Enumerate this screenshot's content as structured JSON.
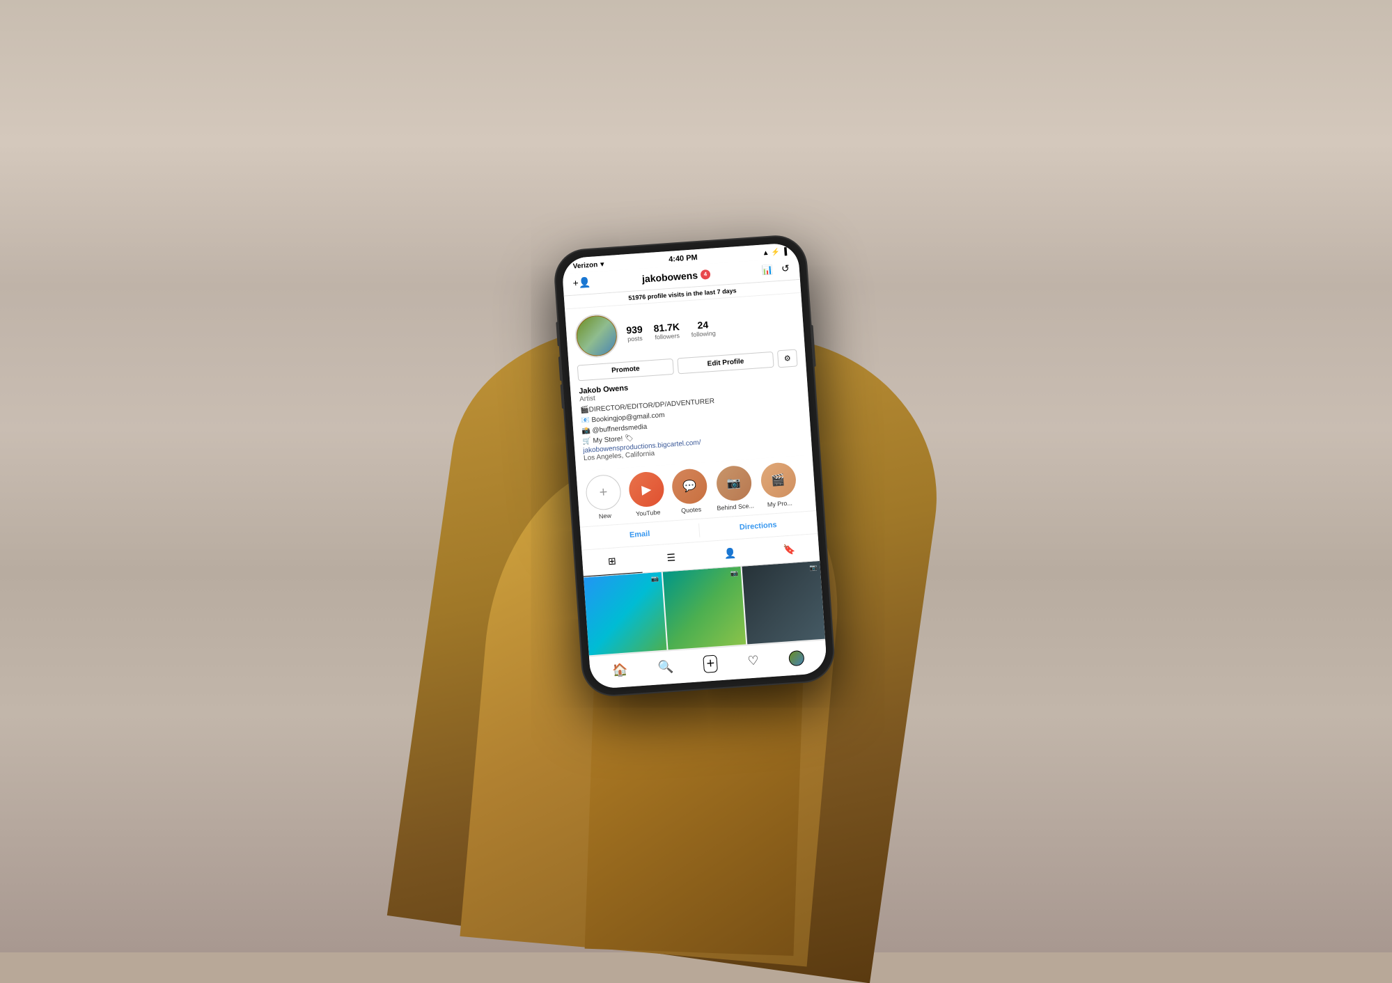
{
  "background": {
    "color": "#b8a898"
  },
  "phone": {
    "status_bar": {
      "carrier": "Verizon",
      "wifi_icon": "wifi",
      "time": "4:40 PM",
      "signal_icon": "signal",
      "bluetooth_icon": "bluetooth",
      "battery_icon": "battery"
    },
    "nav": {
      "add_user_icon": "+👤",
      "username": "jakobowens",
      "badge": "4",
      "chart_icon": "📶",
      "history_icon": "↺"
    },
    "insights": {
      "count": "51976",
      "text": " profile visits in the last 7 days"
    },
    "profile": {
      "stats": [
        {
          "number": "939",
          "label": "posts"
        },
        {
          "number": "81.7K",
          "label": "followers"
        },
        {
          "number": "24",
          "label": "following"
        }
      ],
      "buttons": {
        "promote": "Promote",
        "edit_profile": "Edit Profile",
        "settings": "⚙"
      },
      "bio": {
        "name": "Jakob Owens",
        "category": "Artist",
        "lines": [
          "🎬DIRECTOR/EDITOR/DP/ADVENTURER",
          "📧 Bookingjop@gmail.com",
          "📸 @buffnerdsmedia",
          "🛒 My Store! 🏷",
          "jakobowensproductions.bigcartel.com/",
          "Los Angeles, California"
        ]
      }
    },
    "highlights": [
      {
        "id": "new",
        "label": "New",
        "icon": "+"
      },
      {
        "id": "youtube",
        "label": "YouTube",
        "icon": "▶"
      },
      {
        "id": "quotes",
        "label": "Quotes",
        "icon": "💬"
      },
      {
        "id": "behind",
        "label": "Behind Sce...",
        "icon": "📷"
      },
      {
        "id": "mypro",
        "label": "My Pro...",
        "icon": ""
      }
    ],
    "contact": {
      "email": "Email",
      "directions": "Directions"
    },
    "view_tabs": [
      {
        "id": "grid",
        "icon": "⊞",
        "active": true
      },
      {
        "id": "list",
        "icon": "☰",
        "active": false
      },
      {
        "id": "tag",
        "icon": "👤",
        "active": false
      },
      {
        "id": "bookmark",
        "icon": "🔖",
        "active": false
      }
    ],
    "bottom_nav": [
      {
        "id": "home",
        "icon": "🏠"
      },
      {
        "id": "search",
        "icon": "🔍"
      },
      {
        "id": "add",
        "icon": "⊕"
      },
      {
        "id": "heart",
        "icon": "♡"
      },
      {
        "id": "profile",
        "icon": "avatar"
      }
    ]
  }
}
